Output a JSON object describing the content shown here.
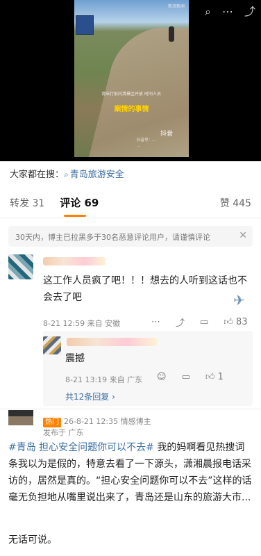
{
  "video": {
    "top_watermark": "新浪新闻",
    "watermark_text": "请出行前问清景区开放 时间人员",
    "subtitle": "案情的事情",
    "platform": "抖音",
    "platform_id": "抖音号：…",
    "platform_id_sub": "…"
  },
  "search": {
    "prefix": "大家都在搜：",
    "query": "青岛旅游安全"
  },
  "tabs": {
    "repost": "转发 31",
    "comments": "评论 69",
    "likes": "赞 445"
  },
  "notice": {
    "text": "30天内，博主已拉黑多于30名恶意评论用户，请谨慎评论"
  },
  "comment1": {
    "text": "这工作人员疯了吧！！！想去的人听到这话也不会去了吧",
    "meta": "8-21 12:59  来自 安徽",
    "like_count": "83"
  },
  "reply1": {
    "text": "震撼",
    "meta": "8-21 13:19  来自 广东",
    "like_count": "1",
    "more_replies": "共12条回复 ›"
  },
  "post": {
    "badge": "热门",
    "meta": "26-8-21 12:35  情感博主",
    "location": "发布于 广东",
    "tag": "#青岛 担心安全问题你可以不去#",
    "body": " 我的妈啊看见热搜词条我以为是假的，特意去看了一下源头，潇湘晨报电话采访的，居然是真的。“担心安全问题你可以不去”这样的话毫无负担地从嘴里说出来了，青岛还是山东的旅游大市...",
    "end": "无话可说。"
  },
  "icons": {
    "top": [
      "search-icon",
      "more-icon",
      "share-icon"
    ],
    "comment_actions": [
      "more-icon",
      "share-icon",
      "reply-icon",
      "like-icon"
    ]
  },
  "colors": {
    "accent": "#ff8200",
    "link": "#3a6ea5"
  }
}
